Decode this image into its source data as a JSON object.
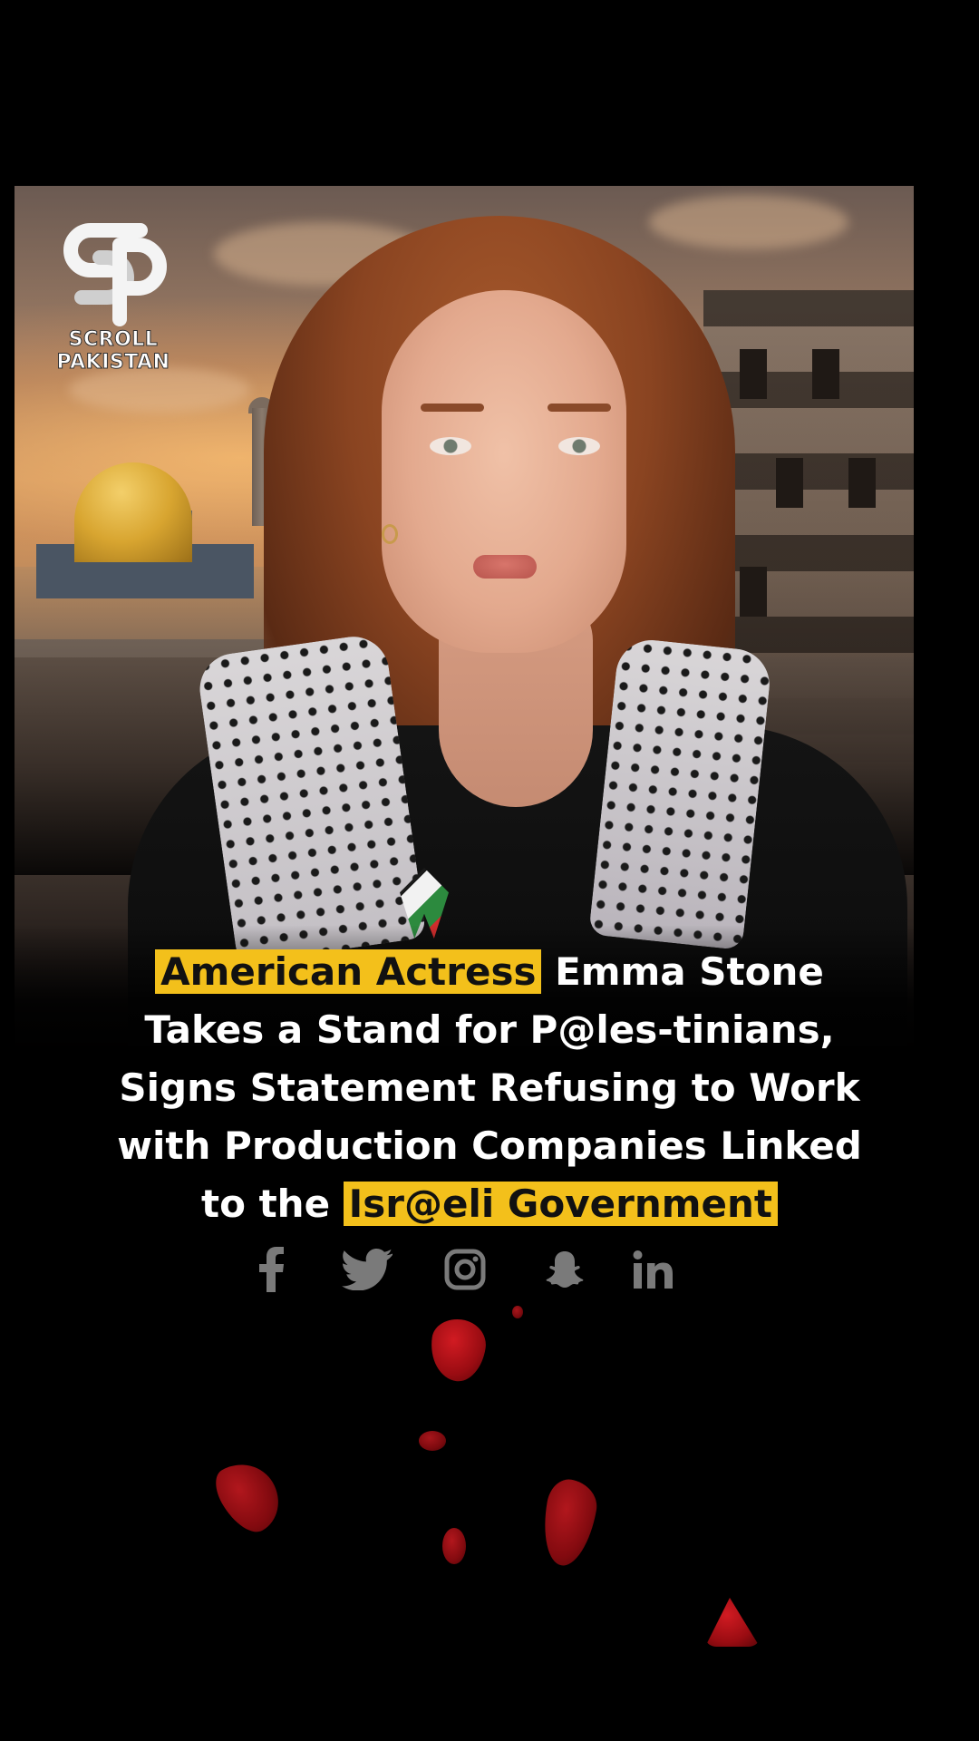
{
  "logo": {
    "line1": "SCROLL",
    "line2": "PAKISTAN"
  },
  "headline": {
    "highlight_start": "American Actress",
    "part1": " Emma Stone",
    "line2": "Takes a Stand for P@les-tinians,",
    "line3": "Signs Statement Refusing to Work",
    "line4": "with Production Companies Linked",
    "line5_prefix": "to the ",
    "highlight_end": "Isr@eli Government"
  },
  "social_icons": [
    "facebook-icon",
    "twitter-icon",
    "instagram-icon",
    "snapchat-icon",
    "linkedin-icon"
  ],
  "colors": {
    "highlight": "#f3c01b",
    "background": "#000000",
    "icon_gray": "#7a7a7a",
    "petal_red": "#c4141b"
  }
}
